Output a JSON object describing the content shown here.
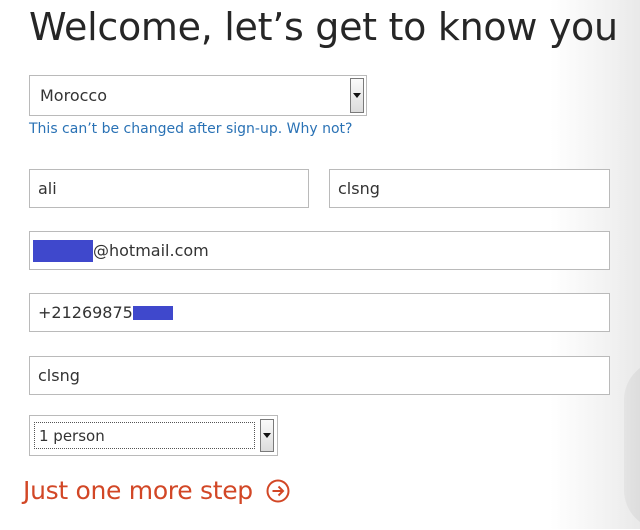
{
  "page": {
    "title": "Welcome, let’s get to know you"
  },
  "country": {
    "selected": "Morocco",
    "hint": "This can’t be changed after sign-up.",
    "hint_link": "Why not?"
  },
  "form": {
    "first_name": "ali",
    "last_name": "clsng",
    "email_domain": "@hotmail.com",
    "phone_prefix": "+21269875",
    "username": "clsng",
    "people_selected": "1 person"
  },
  "actions": {
    "next_label": "Just one more step"
  },
  "colors": {
    "accent": "#d24726",
    "link": "#2a72b5",
    "redaction": "#3f48cc"
  },
  "icons": {
    "next": "arrow-right-circle-icon",
    "dropdown": "triangle-down-icon"
  }
}
